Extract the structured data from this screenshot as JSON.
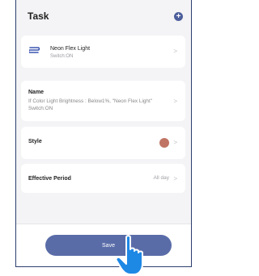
{
  "header": {
    "title": "Task",
    "add_icon": "plus-circle-icon"
  },
  "device": {
    "name": "Neon Flex Light",
    "status": "Switch:ON",
    "icon": "neon-flex-device-icon"
  },
  "name_section": {
    "label": "Name",
    "value": "If Color Light Brightness : Below1%, \"Neon Flex Light\" Switch:ON"
  },
  "style_section": {
    "label": "Style",
    "color": "#c07464"
  },
  "period_section": {
    "label": "Effective Period",
    "value": "All day"
  },
  "footer": {
    "save_label": "Save"
  },
  "colors": {
    "accent": "#5a6ca8",
    "pointer": "#1e88e5"
  }
}
